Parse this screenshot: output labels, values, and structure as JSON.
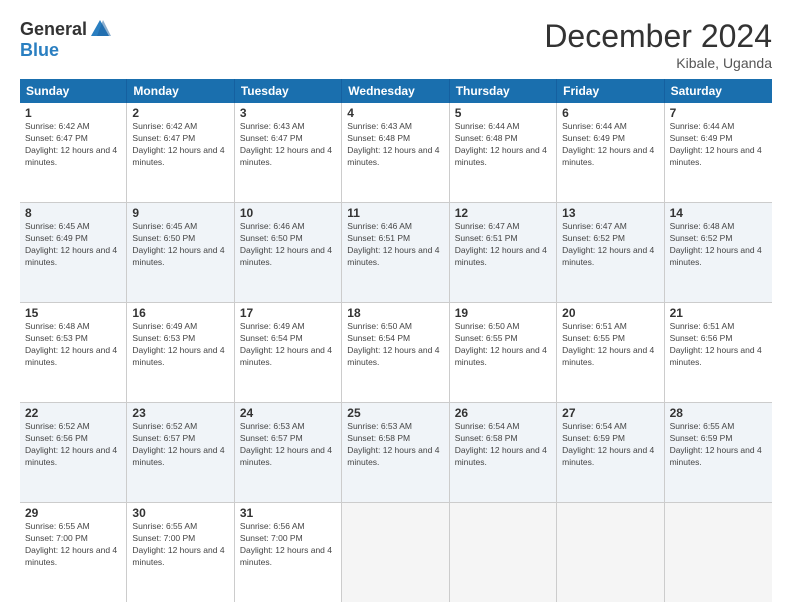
{
  "logo": {
    "general": "General",
    "blue": "Blue"
  },
  "title": "December 2024",
  "location": "Kibale, Uganda",
  "days_of_week": [
    "Sunday",
    "Monday",
    "Tuesday",
    "Wednesday",
    "Thursday",
    "Friday",
    "Saturday"
  ],
  "weeks": [
    [
      {
        "day": "1",
        "sunrise": "6:42 AM",
        "sunset": "6:47 PM",
        "daylight": "12 hours and 4 minutes"
      },
      {
        "day": "2",
        "sunrise": "6:42 AM",
        "sunset": "6:47 PM",
        "daylight": "12 hours and 4 minutes"
      },
      {
        "day": "3",
        "sunrise": "6:43 AM",
        "sunset": "6:47 PM",
        "daylight": "12 hours and 4 minutes"
      },
      {
        "day": "4",
        "sunrise": "6:43 AM",
        "sunset": "6:48 PM",
        "daylight": "12 hours and 4 minutes"
      },
      {
        "day": "5",
        "sunrise": "6:44 AM",
        "sunset": "6:48 PM",
        "daylight": "12 hours and 4 minutes"
      },
      {
        "day": "6",
        "sunrise": "6:44 AM",
        "sunset": "6:49 PM",
        "daylight": "12 hours and 4 minutes"
      },
      {
        "day": "7",
        "sunrise": "6:44 AM",
        "sunset": "6:49 PM",
        "daylight": "12 hours and 4 minutes"
      }
    ],
    [
      {
        "day": "8",
        "sunrise": "6:45 AM",
        "sunset": "6:49 PM",
        "daylight": "12 hours and 4 minutes"
      },
      {
        "day": "9",
        "sunrise": "6:45 AM",
        "sunset": "6:50 PM",
        "daylight": "12 hours and 4 minutes"
      },
      {
        "day": "10",
        "sunrise": "6:46 AM",
        "sunset": "6:50 PM",
        "daylight": "12 hours and 4 minutes"
      },
      {
        "day": "11",
        "sunrise": "6:46 AM",
        "sunset": "6:51 PM",
        "daylight": "12 hours and 4 minutes"
      },
      {
        "day": "12",
        "sunrise": "6:47 AM",
        "sunset": "6:51 PM",
        "daylight": "12 hours and 4 minutes"
      },
      {
        "day": "13",
        "sunrise": "6:47 AM",
        "sunset": "6:52 PM",
        "daylight": "12 hours and 4 minutes"
      },
      {
        "day": "14",
        "sunrise": "6:48 AM",
        "sunset": "6:52 PM",
        "daylight": "12 hours and 4 minutes"
      }
    ],
    [
      {
        "day": "15",
        "sunrise": "6:48 AM",
        "sunset": "6:53 PM",
        "daylight": "12 hours and 4 minutes"
      },
      {
        "day": "16",
        "sunrise": "6:49 AM",
        "sunset": "6:53 PM",
        "daylight": "12 hours and 4 minutes"
      },
      {
        "day": "17",
        "sunrise": "6:49 AM",
        "sunset": "6:54 PM",
        "daylight": "12 hours and 4 minutes"
      },
      {
        "day": "18",
        "sunrise": "6:50 AM",
        "sunset": "6:54 PM",
        "daylight": "12 hours and 4 minutes"
      },
      {
        "day": "19",
        "sunrise": "6:50 AM",
        "sunset": "6:55 PM",
        "daylight": "12 hours and 4 minutes"
      },
      {
        "day": "20",
        "sunrise": "6:51 AM",
        "sunset": "6:55 PM",
        "daylight": "12 hours and 4 minutes"
      },
      {
        "day": "21",
        "sunrise": "6:51 AM",
        "sunset": "6:56 PM",
        "daylight": "12 hours and 4 minutes"
      }
    ],
    [
      {
        "day": "22",
        "sunrise": "6:52 AM",
        "sunset": "6:56 PM",
        "daylight": "12 hours and 4 minutes"
      },
      {
        "day": "23",
        "sunrise": "6:52 AM",
        "sunset": "6:57 PM",
        "daylight": "12 hours and 4 minutes"
      },
      {
        "day": "24",
        "sunrise": "6:53 AM",
        "sunset": "6:57 PM",
        "daylight": "12 hours and 4 minutes"
      },
      {
        "day": "25",
        "sunrise": "6:53 AM",
        "sunset": "6:58 PM",
        "daylight": "12 hours and 4 minutes"
      },
      {
        "day": "26",
        "sunrise": "6:54 AM",
        "sunset": "6:58 PM",
        "daylight": "12 hours and 4 minutes"
      },
      {
        "day": "27",
        "sunrise": "6:54 AM",
        "sunset": "6:59 PM",
        "daylight": "12 hours and 4 minutes"
      },
      {
        "day": "28",
        "sunrise": "6:55 AM",
        "sunset": "6:59 PM",
        "daylight": "12 hours and 4 minutes"
      }
    ],
    [
      {
        "day": "29",
        "sunrise": "6:55 AM",
        "sunset": "7:00 PM",
        "daylight": "12 hours and 4 minutes"
      },
      {
        "day": "30",
        "sunrise": "6:55 AM",
        "sunset": "7:00 PM",
        "daylight": "12 hours and 4 minutes"
      },
      {
        "day": "31",
        "sunrise": "6:56 AM",
        "sunset": "7:00 PM",
        "daylight": "12 hours and 4 minutes"
      },
      null,
      null,
      null,
      null
    ]
  ]
}
